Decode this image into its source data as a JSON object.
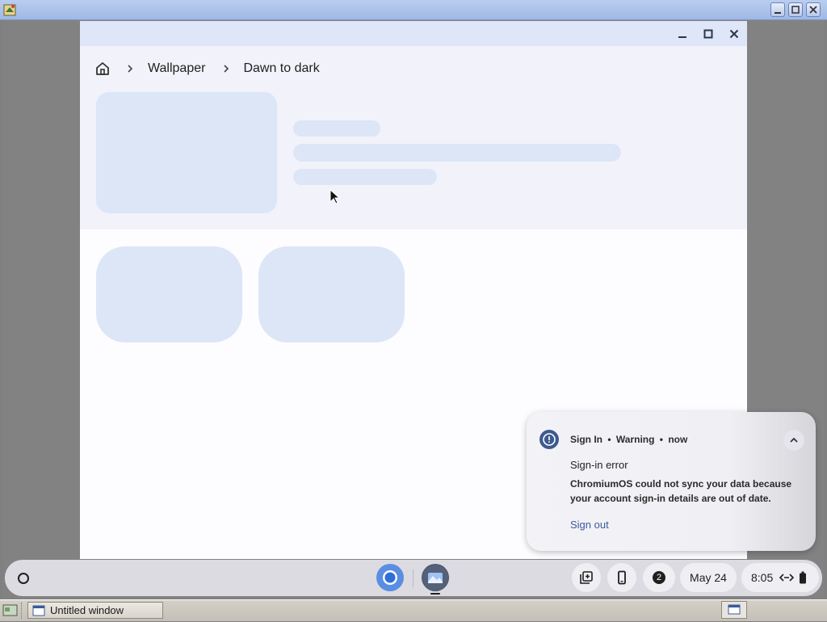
{
  "breadcrumb": {
    "home_icon": "home-icon",
    "items": [
      "Wallpaper",
      "Dawn to dark"
    ]
  },
  "notification": {
    "app": "Sign In",
    "separator": "•",
    "level": "Warning",
    "time": "now",
    "title": "Sign-in error",
    "body": "ChromiumOS could not sync your data because your account sign-in details are out of date.",
    "action": "Sign out"
  },
  "shelf": {
    "notification_count": "2",
    "date": "May 24",
    "time": "8:05"
  },
  "host_taskbar": {
    "window_label": "Untitled window"
  },
  "colors": {
    "accent": "#3a5aa0",
    "skeleton": "#dde6f7",
    "titlebar": "#dfe6f7"
  }
}
